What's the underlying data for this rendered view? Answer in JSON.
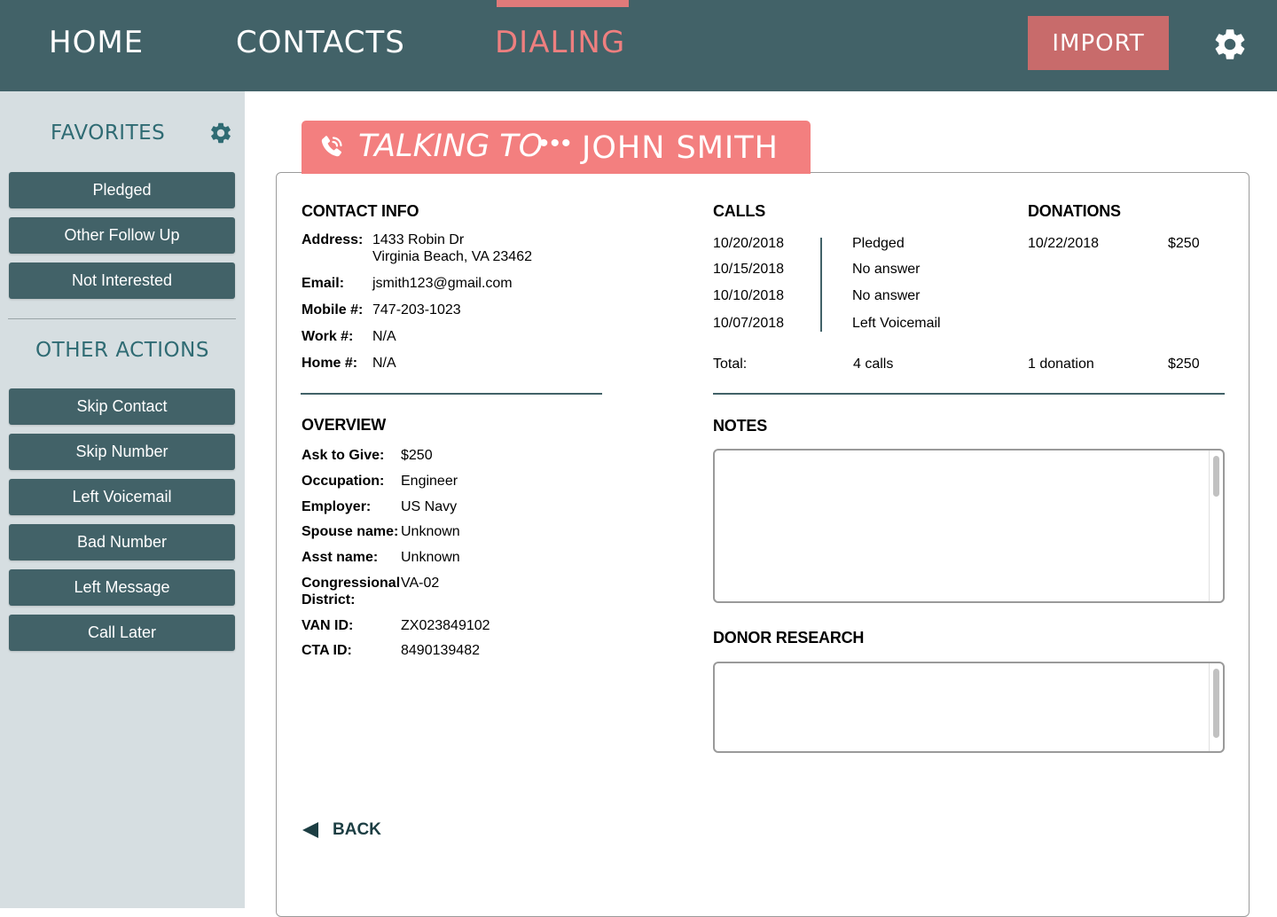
{
  "nav": {
    "tabs": [
      {
        "label": "HOME",
        "active": false
      },
      {
        "label": "CONTACTS",
        "active": false
      },
      {
        "label": "DIALING",
        "active": true
      }
    ],
    "import_label": "IMPORT",
    "settings_icon": "gear-icon"
  },
  "sidebar": {
    "favorites_title": "FAVORITES",
    "favorites_settings_icon": "gear-icon",
    "favorites": [
      "Pledged",
      "Other Follow Up",
      "Not Interested"
    ],
    "other_actions_title": "OTHER ACTIONS",
    "other_actions": [
      "Skip Contact",
      "Skip Number",
      "Left Voicemail",
      "Bad Number",
      "Left Message",
      "Call Later"
    ]
  },
  "banner": {
    "icon": "phone-ringing-icon",
    "label": "TALKING TO",
    "dots": "•••",
    "name": "JOHN SMITH"
  },
  "contact_info": {
    "title": "CONTACT INFO",
    "address_label": "Address:",
    "address_line1": "1433 Robin Dr",
    "address_line2": "Virginia Beach, VA 23462",
    "email_label": "Email:",
    "email": "jsmith123@gmail.com",
    "mobile_label": "Mobile #:",
    "mobile": "747-203-1023",
    "work_label": "Work #:",
    "work": "N/A",
    "home_label": "Home #:",
    "home": "N/A"
  },
  "calls": {
    "title": "CALLS",
    "rows": [
      {
        "date": "10/20/2018",
        "result": "Pledged"
      },
      {
        "date": "10/15/2018",
        "result": "No answer"
      },
      {
        "date": "10/10/2018",
        "result": "No answer"
      },
      {
        "date": "10/07/2018",
        "result": "Left Voicemail"
      }
    ],
    "total_label": "Total:",
    "total_value": "4 calls"
  },
  "donations": {
    "title": "DONATIONS",
    "rows": [
      {
        "date": "10/22/2018",
        "amount": "$250"
      }
    ],
    "total_count": "1 donation",
    "total_amount": "$250"
  },
  "overview": {
    "title": "OVERVIEW",
    "ask_label": "Ask to Give:",
    "ask": "$250",
    "occupation_label": "Occupation:",
    "occupation": "Engineer",
    "employer_label": "Employer:",
    "employer": "US Navy",
    "spouse_label": "Spouse name:",
    "spouse": "Unknown",
    "asst_label": "Asst name:",
    "asst": "Unknown",
    "district_label_1": "Congressional",
    "district_label_2": "District:",
    "district": "VA-02",
    "van_label": "VAN ID:",
    "van": "ZX023849102",
    "cta_label": "CTA ID:",
    "cta": "8490139482"
  },
  "notes": {
    "title": "NOTES",
    "value": ""
  },
  "donor_research": {
    "title": "DONOR RESEARCH",
    "value": ""
  },
  "back": {
    "label": "BACK",
    "icon": "back-arrow-icon"
  },
  "colors": {
    "nav_bg": "#426268",
    "accent": "#f37f7f",
    "import_bg": "#c86b6b",
    "sidebar_bg": "#d6dee1",
    "heading_teal": "#2f6b73"
  }
}
